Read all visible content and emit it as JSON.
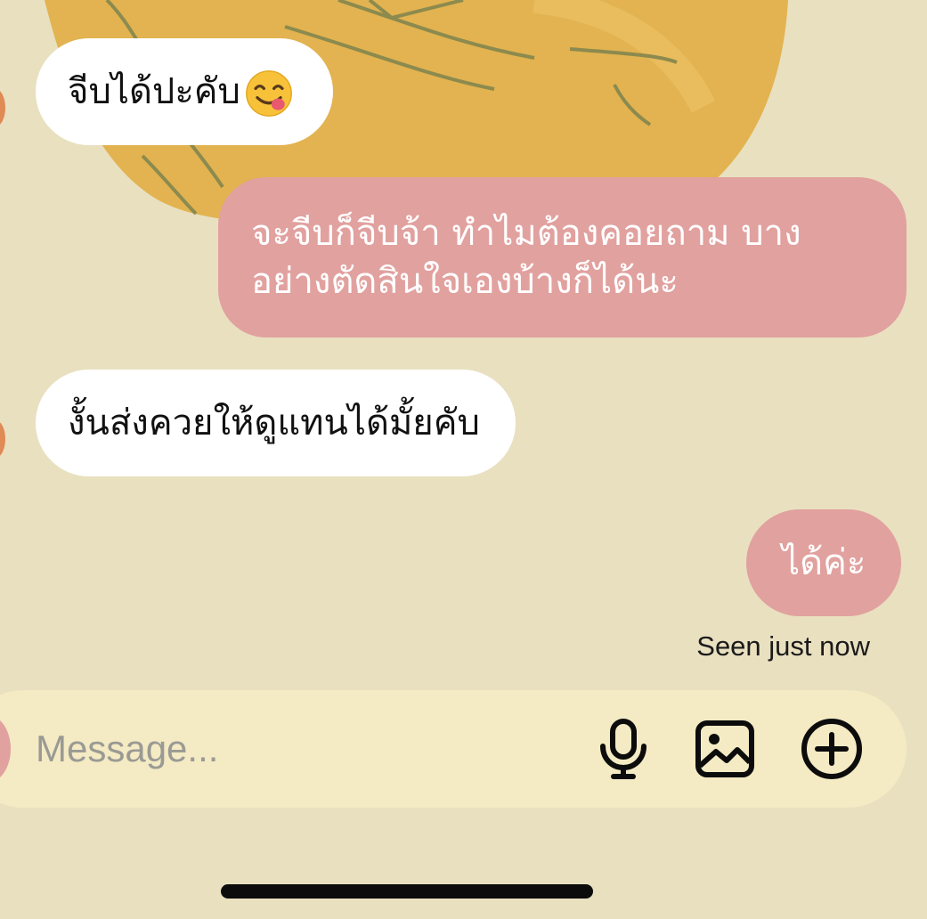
{
  "colors": {
    "background": "#e9e0c0",
    "incoming_bubble": "#ffffff",
    "outgoing_bubble": "#e1a19f",
    "composer": "#f4eac3",
    "illustration": "#e2b350",
    "illustration_lines": "#8c8a4e"
  },
  "messages": [
    {
      "sender": "other",
      "text": "จีบได้ปะคับ",
      "emoji": "face-savoring-food-emoji"
    },
    {
      "sender": "me",
      "line1": "จะจีบก็จีบจ้า ทำไมต้องคอยถาม บาง",
      "line2": "อย่างตัดสินใจเองบ้างก็ได้นะ"
    },
    {
      "sender": "other",
      "text": "งั้นส่งควยให้ดูแทนได้มั้ยคับ"
    },
    {
      "sender": "me",
      "text": "ได้ค่ะ"
    }
  ],
  "status": {
    "seen_text": "Seen just now"
  },
  "composer": {
    "placeholder": "Message...",
    "value": "",
    "icons": [
      "microphone-icon",
      "image-icon",
      "add-circle-icon"
    ]
  }
}
